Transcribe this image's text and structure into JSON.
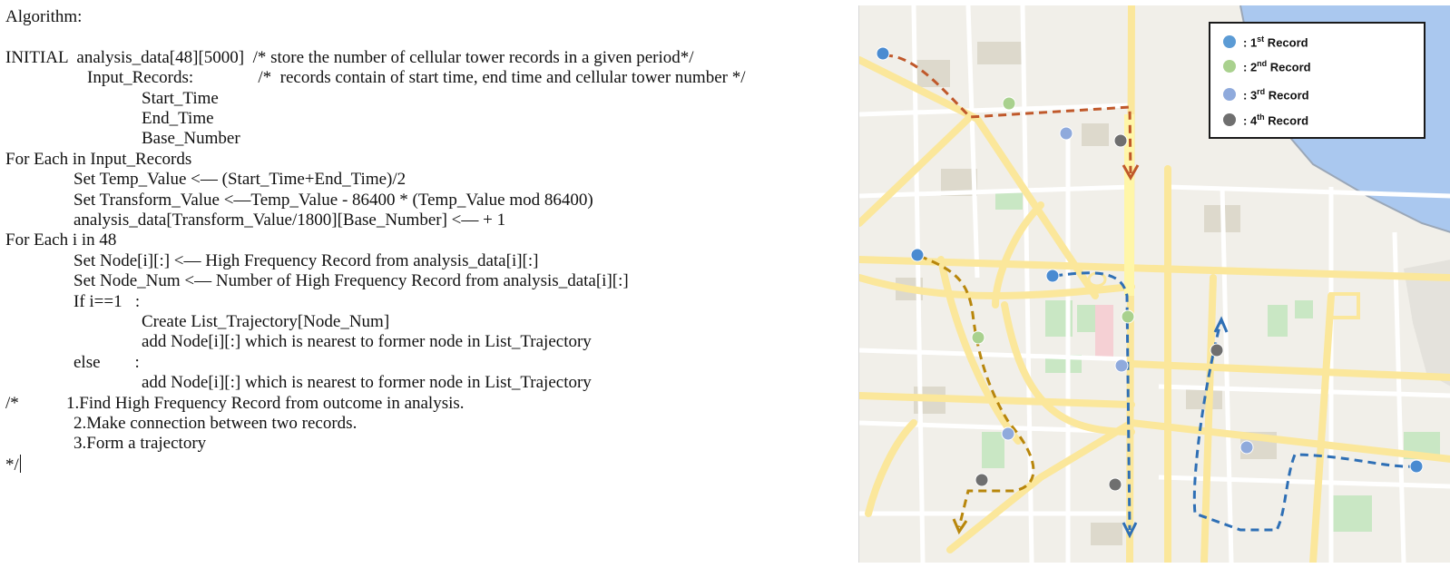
{
  "algorithm": {
    "lines": [
      {
        "indent": 0,
        "text": "Algorithm:"
      },
      {
        "indent": 0,
        "text": ""
      },
      {
        "indent": 0,
        "text": "INITIAL  analysis_data[48][5000]  /* store the number of cellular tower records in a given period*/"
      },
      {
        "indent": 90,
        "text": "Input_Records:               /*  records contain of start time, end time and cellular tower number */"
      },
      {
        "indent": 150,
        "text": "Start_Time"
      },
      {
        "indent": 150,
        "text": "End_Time"
      },
      {
        "indent": 150,
        "text": "Base_Number"
      },
      {
        "indent": 0,
        "text": "For Each in Input_Records"
      },
      {
        "indent": 75,
        "text": "Set Temp_Value <— (Start_Time+End_Time)/2"
      },
      {
        "indent": 75,
        "text": "Set Transform_Value <—Temp_Value - 86400 * (Temp_Value mod 86400)"
      },
      {
        "indent": 75,
        "text": "analysis_data[Transform_Value/1800][Base_Number] <— + 1"
      },
      {
        "indent": 0,
        "text": "For Each i in 48"
      },
      {
        "indent": 75,
        "text": "Set Node[i][:] <— High Frequency Record from analysis_data[i][:]"
      },
      {
        "indent": 75,
        "text": "Set Node_Num <— Number of High Frequency Record from analysis_data[i][:]"
      },
      {
        "indent": 75,
        "text": "If i==1   :"
      },
      {
        "indent": 150,
        "text": "Create List_Trajectory[Node_Num]"
      },
      {
        "indent": 150,
        "text": "add Node[i][:] which is nearest to former node in List_Trajectory"
      },
      {
        "indent": 75,
        "text": "else        :"
      },
      {
        "indent": 150,
        "text": "add Node[i][:] which is nearest to former node in List_Trajectory"
      },
      {
        "indent": 0,
        "text": "/*           1.Find High Frequency Record from outcome in analysis."
      },
      {
        "indent": 75,
        "text": "2.Make connection between two records."
      },
      {
        "indent": 75,
        "text": "3.Form a trajectory"
      },
      {
        "indent": 0,
        "text": "*/"
      }
    ]
  },
  "legend": {
    "items": [
      {
        "prefix": ": 1",
        "sup": "st",
        "suffix": " Record",
        "color": "#5b9bd5"
      },
      {
        "prefix": ": 2",
        "sup": "nd",
        "suffix": " Record",
        "color": "#a9d18e"
      },
      {
        "prefix": ": 3",
        "sup": "rd",
        "suffix": " Record",
        "color": "#8faadc"
      },
      {
        "prefix": ": 4",
        "sup": "th",
        "suffix": " Record",
        "color": "#6f6f6f"
      }
    ]
  },
  "colors": {
    "map_background": "#f1efe9",
    "road_major": "#fbe79b",
    "road_minor": "#ffffff",
    "water": "#aac8ef",
    "park": "#c9e7c4",
    "trajectory_orange": "#c0582a",
    "trajectory_gold": "#b8860b",
    "trajectory_blue": "#2e6fb5"
  }
}
